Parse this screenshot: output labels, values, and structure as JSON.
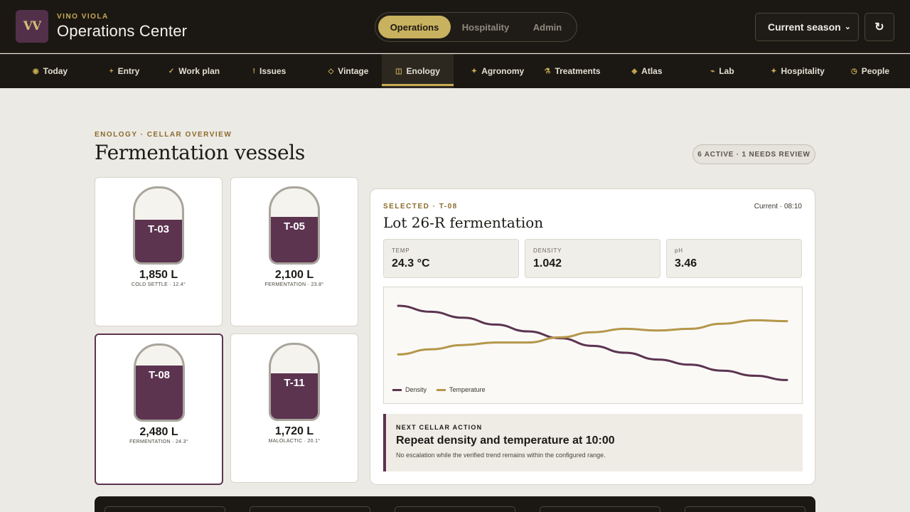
{
  "header": {
    "logo": "VV",
    "brand": "VINO VIOLA",
    "title": "Operations Center",
    "modes": [
      "Operations",
      "Hospitality",
      "Admin"
    ],
    "active_mode": "Operations",
    "season": "Current season",
    "refresh_icon": "refresh-icon"
  },
  "nav": [
    {
      "label": "Today",
      "icon": "◉",
      "icon_name": "today-icon"
    },
    {
      "label": "Entry",
      "icon": "+",
      "icon_name": "plus-icon"
    },
    {
      "label": "Work plan",
      "icon": "✓",
      "icon_name": "check-icon"
    },
    {
      "label": "Issues",
      "icon": "!",
      "icon_name": "alert-icon"
    },
    {
      "label": "Vintage",
      "icon": "◇",
      "icon_name": "diamond-icon"
    },
    {
      "label": "Enology",
      "icon": "◫",
      "icon_name": "vessel-icon"
    },
    {
      "label": "Agronomy",
      "icon": "✦",
      "icon_name": "leaf-icon"
    },
    {
      "label": "Treatments",
      "icon": "⚗",
      "icon_name": "flask-icon"
    },
    {
      "label": "Atlas",
      "icon": "◈",
      "icon_name": "map-icon"
    },
    {
      "label": "Lab",
      "icon": "⌁",
      "icon_name": "lab-icon"
    },
    {
      "label": "Hospitality",
      "icon": "✦",
      "icon_name": "star-icon"
    },
    {
      "label": "People",
      "icon": "◷",
      "icon_name": "people-icon"
    }
  ],
  "nav_active": "Enology",
  "main": {
    "crumb": "ENOLOGY · CELLAR OVERVIEW",
    "title": "Fermentation vessels",
    "badge": "6 ACTIVE · 1 NEEDS REVIEW"
  },
  "tanks": [
    {
      "id": "T-03",
      "volume": "1,850 L",
      "status": "COLD SETTLE · 12.4°",
      "fill": 0.58,
      "selected": false
    },
    {
      "id": "T-05",
      "volume": "2,100 L",
      "status": "FERMENTATION · 23.8°",
      "fill": 0.62,
      "selected": false
    },
    {
      "id": "T-08",
      "volume": "2,480 L",
      "status": "FERMENTATION · 24.3°",
      "fill": 0.73,
      "selected": true
    },
    {
      "id": "T-11",
      "volume": "1,720 L",
      "status": "MALOLACTIC · 20.1°",
      "fill": 0.62,
      "selected": false
    }
  ],
  "detail": {
    "selected_label": "SELECTED · T-08",
    "current": "Current · 08:10",
    "title": "Lot 26-R fermentation",
    "metrics": [
      {
        "label": "TEMP",
        "value": "24.3 °C"
      },
      {
        "label": "DENSITY",
        "value": "1.042"
      },
      {
        "label": "pH",
        "value": "3.46"
      }
    ],
    "action": {
      "label": "NEXT CELLAR ACTION",
      "title": "Repeat density and temperature at 10:00",
      "note": "No escalation while the verified trend remains within the configured range."
    }
  },
  "chart_data": {
    "type": "line",
    "x": [
      0,
      1,
      2,
      3,
      4,
      5,
      6,
      7,
      8,
      9,
      10,
      11,
      12
    ],
    "series": [
      {
        "name": "Density",
        "color": "#5c3450",
        "values": [
          0.95,
          0.88,
          0.81,
          0.73,
          0.65,
          0.57,
          0.48,
          0.4,
          0.32,
          0.26,
          0.19,
          0.13,
          0.08
        ]
      },
      {
        "name": "Temperature",
        "color": "#b5974a",
        "values": [
          0.38,
          0.44,
          0.49,
          0.52,
          0.52,
          0.58,
          0.64,
          0.68,
          0.66,
          0.68,
          0.74,
          0.78,
          0.77
        ]
      }
    ],
    "grid": false,
    "legend": "bottom-left"
  }
}
